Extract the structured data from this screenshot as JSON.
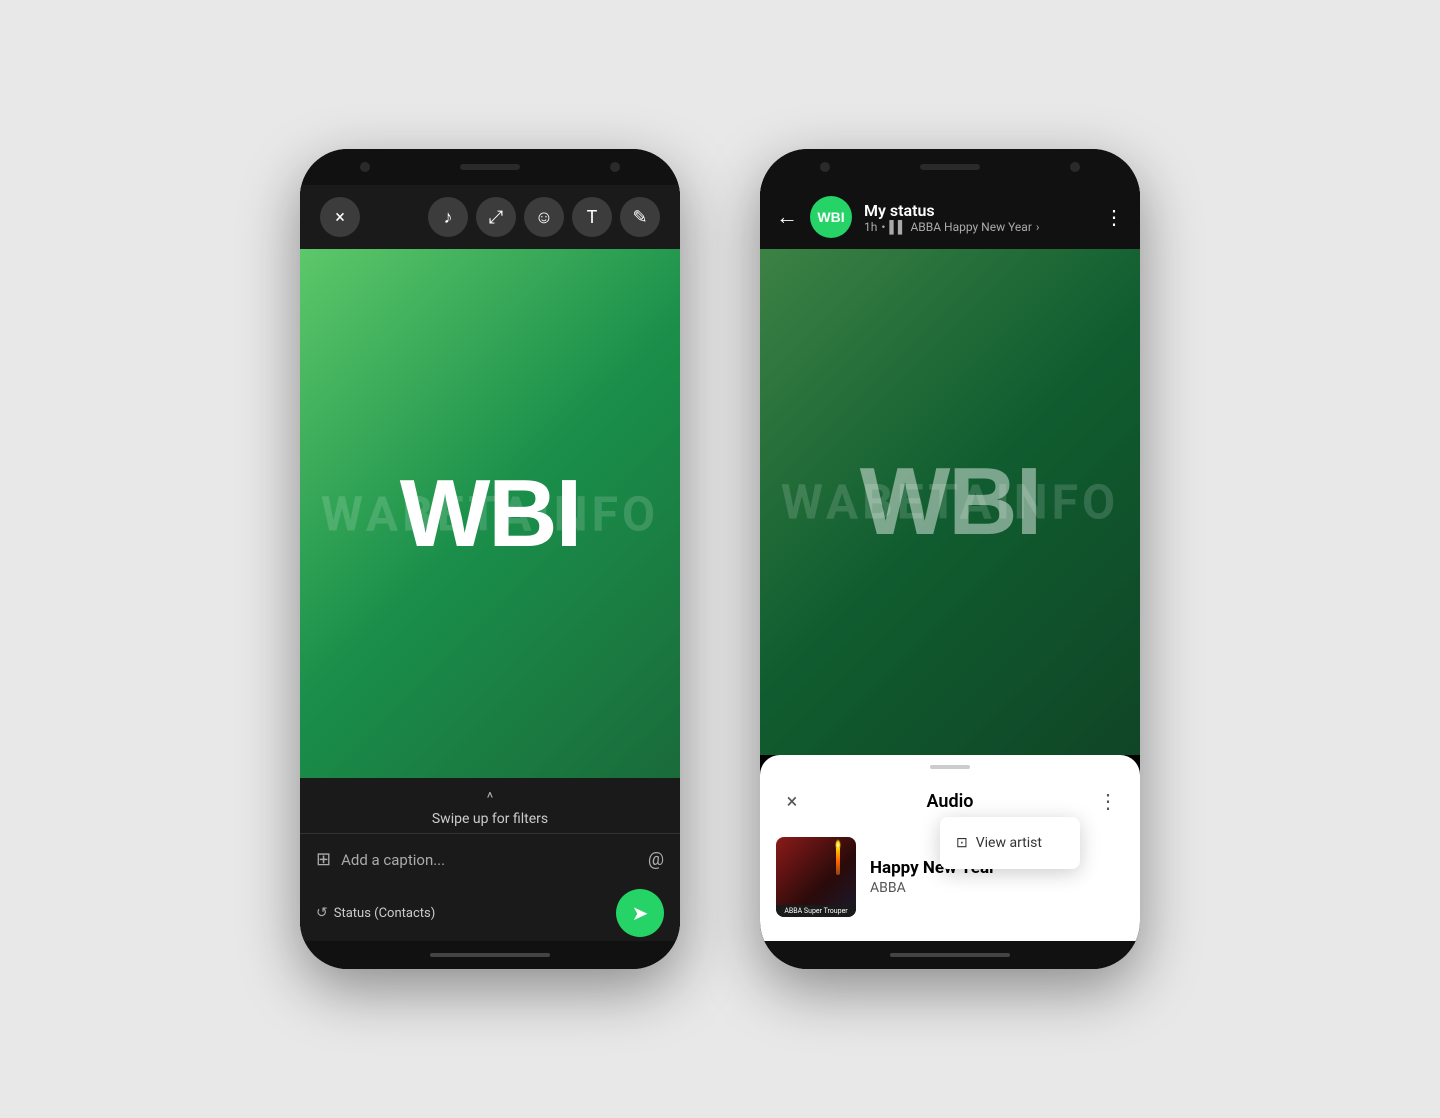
{
  "page": {
    "bg_color": "#e8e8e8"
  },
  "left_phone": {
    "toolbar": {
      "close_btn": "×",
      "music_icon": "♪",
      "crop_icon": "⤢",
      "emoji_icon": "☺",
      "text_icon": "T",
      "draw_icon": "✎"
    },
    "logo": "WBI",
    "watermark": "WABETAINFO",
    "swipe": {
      "chevron": "^",
      "text": "Swipe up for filters"
    },
    "caption": {
      "placeholder": "Add a caption...",
      "gallery_icon": "⊞",
      "at_icon": "@"
    },
    "send_bar": {
      "privacy_icon": "↺",
      "privacy_label": "Status (Contacts)",
      "send_icon": "➤"
    }
  },
  "right_phone": {
    "header": {
      "back_icon": "←",
      "avatar_text": "WBI",
      "title": "My status",
      "time": "1h",
      "song_info": "ABBA Happy New Year",
      "more_icon": "⋮"
    },
    "logo": "WBI",
    "bottom_sheet": {
      "close_icon": "×",
      "title": "Audio",
      "more_icon": "⋮",
      "album_label": "ABBA Super Trouper",
      "track_title": "Happy New Year",
      "track_artist": "ABBA",
      "context_menu": {
        "view_artist_icon": "⊡",
        "view_artist_label": "View artist"
      }
    }
  }
}
